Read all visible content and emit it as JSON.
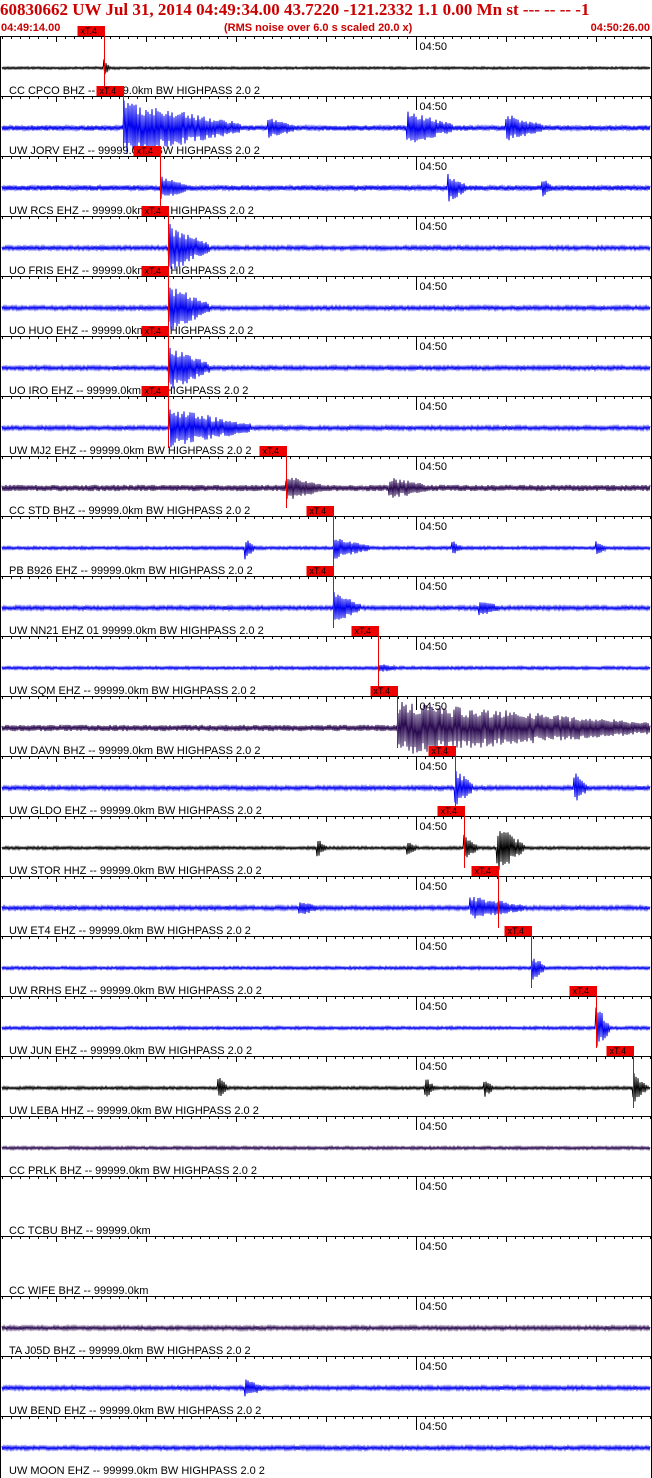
{
  "header": {
    "title": "60830662 UW Jul 31, 2014 04:49:34.00   43.7220 -121.2332  1.1 0.00 Mn st --- -- --  -1",
    "start_time": "04:49:14.00",
    "noise_note": "(RMS noise over 6.0 s scaled 20.0 x)",
    "end_time": "04:50:26.00"
  },
  "colors": {
    "header": "#cc0000",
    "grid": "#000000",
    "blue_trace": "#0000ee",
    "dark_trace": "#2a0a50",
    "black_trace": "#000000",
    "marker": "#ee0000",
    "marker_text": "#000000"
  },
  "chart_data": {
    "type": "seismogram",
    "time_start": "04:49:14.00",
    "time_end": "04:50:26.00",
    "minute_label": "04:50",
    "minute_tick_seconds": 46,
    "pick_label": "xT.4",
    "traces": [
      {
        "label": "CC CPCO BHZ -- 99999.0km BW  HIGHPASS  2.0  2",
        "color": "#000000",
        "noise": 1.2,
        "pick_seconds": 11.3,
        "bursts": [
          {
            "t": 11.3,
            "dur": 0.6,
            "amp": 10
          }
        ]
      },
      {
        "label": "UW JORV EHZ -- 99999.0km BW  HIGHPASS  2.0  2",
        "color": "#0000ee",
        "noise": 2.5,
        "pick_seconds": 13.4,
        "bursts": [
          {
            "t": 13.5,
            "dur": 13,
            "amp": 30
          },
          {
            "t": 29.5,
            "dur": 3,
            "amp": 10
          },
          {
            "t": 45,
            "dur": 5,
            "amp": 18
          },
          {
            "t": 56,
            "dur": 4,
            "amp": 14
          }
        ]
      },
      {
        "label": "UW RCS EHZ -- 99999.0km BW  HIGHPASS  2.0  2",
        "color": "#0000ee",
        "noise": 2.5,
        "pick_seconds": 17.6,
        "bursts": [
          {
            "t": 17.6,
            "dur": 3,
            "amp": 12
          },
          {
            "t": 49.5,
            "dur": 2,
            "amp": 16
          },
          {
            "t": 60,
            "dur": 1,
            "amp": 9
          }
        ]
      },
      {
        "label": "UO FRIS EHZ -- 99999.0km BW  HIGHPASS  2.0  2",
        "color": "#0000ee",
        "noise": 2.0,
        "pick_seconds": 18.5,
        "bursts": [
          {
            "t": 18.5,
            "dur": 4.5,
            "amp": 28
          }
        ]
      },
      {
        "label": "UO HUO EHZ -- 99999.0km BW  HIGHPASS  2.0  2",
        "color": "#0000ee",
        "noise": 2.0,
        "pick_seconds": 18.5,
        "bursts": [
          {
            "t": 18.5,
            "dur": 4.5,
            "amp": 28
          }
        ]
      },
      {
        "label": "UO IRO EHZ -- 99999.0km BW  HIGHPASS  2.0  2",
        "color": "#0000ee",
        "noise": 2.0,
        "pick_seconds": 18.5,
        "bursts": [
          {
            "t": 18.5,
            "dur": 4.5,
            "amp": 28
          }
        ]
      },
      {
        "label": "UW MJ2 EHZ -- 99999.0km BW  HIGHPASS  2.0  2",
        "color": "#0000ee",
        "noise": 2.0,
        "pick_seconds": 18.5,
        "bursts": [
          {
            "t": 18.6,
            "dur": 9,
            "amp": 22
          }
        ]
      },
      {
        "label": "CC STD BHZ -- 99999.0km BW  HIGHPASS  2.0  2",
        "color": "#2a0a50",
        "noise": 3.0,
        "pick_seconds": 31.5,
        "bursts": [
          {
            "t": 31.5,
            "dur": 4,
            "amp": 12
          },
          {
            "t": 43,
            "dur": 4,
            "amp": 10
          }
        ]
      },
      {
        "label": "PB B926 EHZ -- 99999.0km BW  HIGHPASS  2.0  2",
        "color": "#0000ee",
        "noise": 1.5,
        "pick_seconds": 36.8,
        "bursts": [
          {
            "t": 27,
            "dur": 1,
            "amp": 12
          },
          {
            "t": 36.8,
            "dur": 4,
            "amp": 12
          },
          {
            "t": 50,
            "dur": 1,
            "amp": 8
          },
          {
            "t": 66,
            "dur": 1,
            "amp": 8
          }
        ]
      },
      {
        "label": "UW NN21 EHZ 01 99999.0km BW  HIGHPASS  2.0  2",
        "color": "#0000ee",
        "noise": 2.0,
        "pick_seconds": 36.8,
        "bursts": [
          {
            "t": 36.8,
            "dur": 3,
            "amp": 18
          },
          {
            "t": 53,
            "dur": 2,
            "amp": 9
          }
        ]
      },
      {
        "label": "UW SQM EHZ -- 99999.0km BW  HIGHPASS  2.0  2",
        "color": "#0000ee",
        "noise": 1.5,
        "pick_seconds": 41.8,
        "bursts": [
          {
            "t": 41.8,
            "dur": 2,
            "amp": 4
          }
        ]
      },
      {
        "label": "UW DAVN BHZ -- 99999.0km BW  HIGHPASS  2.0  2",
        "color": "#2a0a50",
        "noise": 3.0,
        "pick_seconds": 43.9,
        "bursts": [
          {
            "t": 43.9,
            "dur": 28,
            "amp": 28
          }
        ]
      },
      {
        "label": "UW GLDO EHZ -- 99999.0km BW  HIGHPASS  2.0  2",
        "color": "#0000ee",
        "noise": 2.0,
        "pick_seconds": 50.3,
        "bursts": [
          {
            "t": 50.3,
            "dur": 2,
            "amp": 22
          },
          {
            "t": 63.5,
            "dur": 1.5,
            "amp": 18
          }
        ]
      },
      {
        "label": "UW STOR HHZ -- 99999.0km BW  HIGHPASS  2.0  2",
        "color": "#000000",
        "noise": 1.5,
        "pick_seconds": 51.3,
        "bursts": [
          {
            "t": 51.3,
            "dur": 1.5,
            "amp": 18
          },
          {
            "t": 55,
            "dur": 3,
            "amp": 28
          },
          {
            "t": 35,
            "dur": 1,
            "amp": 10
          },
          {
            "t": 45,
            "dur": 1,
            "amp": 8
          }
        ]
      },
      {
        "label": "UW ET4 EHZ -- 99999.0km BW  HIGHPASS  2.0  2",
        "color": "#0000ee",
        "noise": 2.0,
        "pick_seconds": 55.1,
        "bursts": [
          {
            "t": 52,
            "dur": 6,
            "amp": 12
          },
          {
            "t": 33,
            "dur": 2,
            "amp": 8
          }
        ]
      },
      {
        "label": "UW RRHS EHZ -- 99999.0km BW  HIGHPASS  2.0  2",
        "color": "#0000ee",
        "noise": 1.5,
        "pick_seconds": 58.8,
        "bursts": [
          {
            "t": 58.8,
            "dur": 1.5,
            "amp": 16
          }
        ]
      },
      {
        "label": "UW JUN EHZ -- 99999.0km BW  HIGHPASS  2.0  2",
        "color": "#0000ee",
        "noise": 1.5,
        "pick_seconds": 66.0,
        "bursts": [
          {
            "t": 66.0,
            "dur": 1.5,
            "amp": 28
          }
        ]
      },
      {
        "label": "UW LEBA HHZ -- 99999.0km BW  HIGHPASS  2.0  2",
        "color": "#000000",
        "noise": 1.5,
        "pick_seconds": 70.1,
        "bursts": [
          {
            "t": 24,
            "dur": 1,
            "amp": 14
          },
          {
            "t": 47,
            "dur": 1,
            "amp": 12
          },
          {
            "t": 53.5,
            "dur": 1,
            "amp": 12
          },
          {
            "t": 70.1,
            "dur": 1.5,
            "amp": 18
          }
        ]
      },
      {
        "label": "CC PRLK BHZ -- 99999.0km BW  HIGHPASS  2.0  2",
        "color": "#2a0a50",
        "noise": 1.5,
        "pick_seconds": null,
        "bursts": []
      },
      {
        "label": "CC TCBU BHZ -- 99999.0km",
        "color": "#000000",
        "noise": 0,
        "pick_seconds": null,
        "bursts": []
      },
      {
        "label": "CC WIFE BHZ -- 99999.0km",
        "color": "#000000",
        "noise": 0,
        "pick_seconds": null,
        "bursts": []
      },
      {
        "label": "TA J05D BHZ -- 99999.0km BW  HIGHPASS  2.0  2",
        "color": "#2a0a50",
        "noise": 2.0,
        "pick_seconds": null,
        "bursts": []
      },
      {
        "label": "UW BEND EHZ -- 99999.0km BW  HIGHPASS  2.0  2",
        "color": "#0000ee",
        "noise": 2.0,
        "pick_seconds": null,
        "bursts": [
          {
            "t": 27,
            "dur": 2,
            "amp": 9
          }
        ]
      },
      {
        "label": "UW MOON EHZ -- 99999.0km BW  HIGHPASS  2.0  2",
        "color": "#0000ee",
        "noise": 2.0,
        "pick_seconds": null,
        "bursts": []
      }
    ]
  }
}
